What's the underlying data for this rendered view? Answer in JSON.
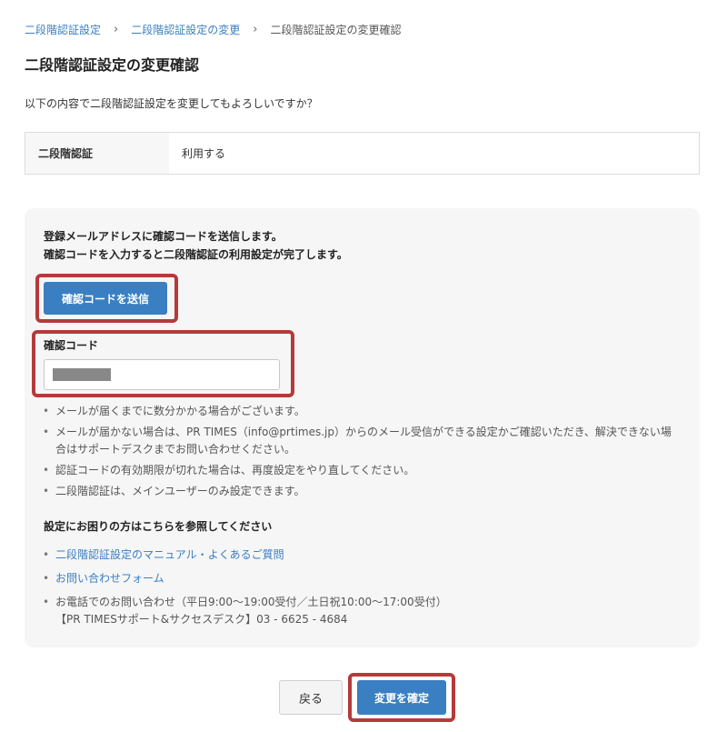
{
  "breadcrumb": {
    "items": [
      "二段階認証設定",
      "二段階認証設定の変更"
    ],
    "current": "二段階認証設定の変更確認",
    "separator": "›"
  },
  "page_title": "二段階認証設定の変更確認",
  "intro": "以下の内容で二段階認証設定を変更してもよろしいですか？",
  "setting": {
    "label": "二段階認証",
    "value": "利用する"
  },
  "panel": {
    "desc_line1": "登録メールアドレスに確認コードを送信します。",
    "desc_line2": "確認コードを入力すると二段階認証の利用設定が完了します。",
    "send_button": "確認コードを送信",
    "code_label": "確認コード",
    "notes": [
      "メールが届くまでに数分かかる場合がございます。",
      "メールが届かない場合は、PR TIMES（info@prtimes.jp）からのメール受信ができる設定かご確認いただき、解決できない場合はサポートデスクまでお問い合わせください。",
      "認証コードの有効期限が切れた場合は、再度設定をやり直してください。",
      "二段階認証は、メインユーザーのみ設定できます。"
    ],
    "help_title": "設定にお困りの方はこちらを参照してください",
    "help_links": [
      "二段階認証設定のマニュアル・よくあるご質問",
      "お問い合わせフォーム"
    ],
    "phone_line1": "お電話でのお問い合わせ（平日9:00〜19:00受付／土日祝10:00〜17:00受付）",
    "phone_line2": "【PR TIMESサポート&サクセスデスク】03 - 6625 - 4684"
  },
  "buttons": {
    "back": "戻る",
    "confirm": "変更を確定"
  },
  "colors": {
    "accent": "#3a7fc1",
    "highlight": "#b53a3a",
    "panel_bg": "#f6f6f6"
  }
}
